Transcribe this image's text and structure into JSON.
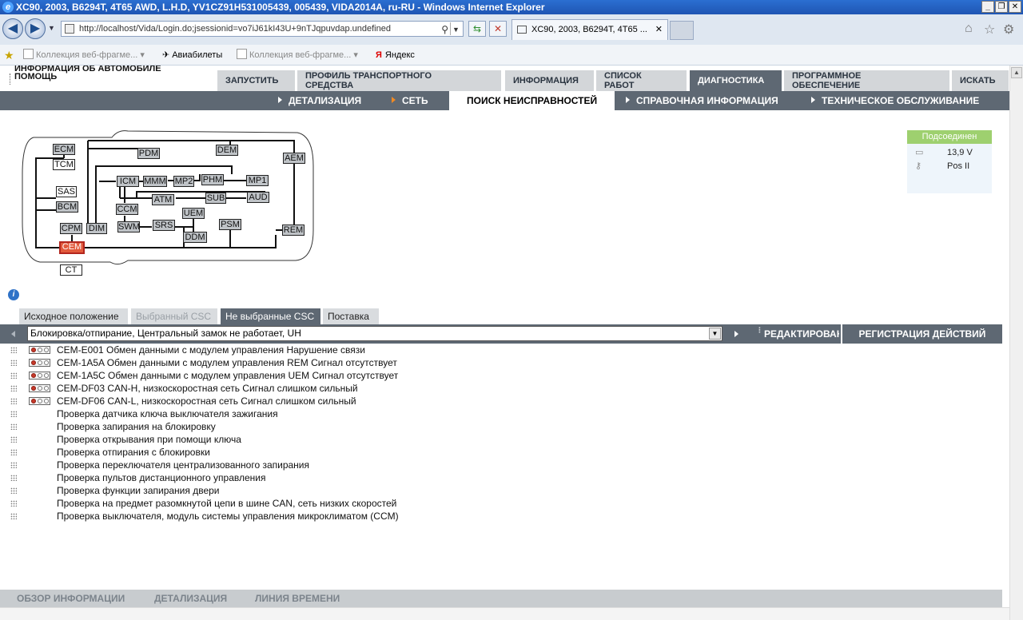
{
  "window": {
    "title": "XC90, 2003, B6294T, 4T65 AWD, L.H.D, YV1CZ91H531005439, 005439, VIDA2014A, ru-RU - Windows Internet Explorer"
  },
  "browser": {
    "url": "http://localhost/Vida/Login.do;jsessionid=vo7iJ61kI43U+9nTJqpuvdap.undefined",
    "tab_title": "XC90, 2003, B6294T, 4T65 ...",
    "favorites": [
      "Коллекция веб-фрагме...",
      "Авиабилеты",
      "Коллекция веб-фрагме...",
      "Яндекс"
    ]
  },
  "app": {
    "title_line1": "ИНФОРМАЦИЯ ОБ АВТОМОБИЛЕ",
    "title_line2": "ПОМОЩЬ",
    "main_tabs": [
      {
        "line1": "ЗАПУСТИТЬ",
        "line2": ""
      },
      {
        "line1": "ПРОФИЛЬ ТРАНСПОРТНОГО",
        "line2": "СРЕДСТВА"
      },
      {
        "line1": "ИНФОРМАЦИЯ",
        "line2": ""
      },
      {
        "line1": "СПИСОК",
        "line2": "РАБОТ"
      },
      {
        "line1": "ДИАГНОСТИКА",
        "line2": ""
      },
      {
        "line1": "ПРОГРАММНОЕ",
        "line2": "ОБЕСПЕЧЕНИЕ"
      },
      {
        "line1": "ИСКАТЬ",
        "line2": ""
      }
    ],
    "active_main_tab": "ДИАГНОСТИКА",
    "sub_tabs": [
      "ДЕТАЛИЗАЦИЯ",
      "СЕТЬ",
      "ПОИСК НЕИСПРАВНОСТЕЙ",
      "СПРАВОЧНАЯ ИНФОРМАЦИЯ",
      "ТЕХНИЧЕСКОЕ ОБСЛУЖИВАНИЕ"
    ],
    "active_sub_tab": "ПОИСК НЕИСПРАВНОСТЕЙ"
  },
  "network": {
    "modules": [
      "ECM",
      "TCM",
      "PDM",
      "DEM",
      "AEM",
      "ICM",
      "MMM",
      "MP2",
      "PHM",
      "MP1",
      "ATM",
      "SUB",
      "AUD",
      "SAS",
      "BCM",
      "CCM",
      "UEM",
      "SWM",
      "SRS",
      "DDM",
      "PSM",
      "CPM",
      "DIM",
      "REM",
      "CEM",
      "CT"
    ],
    "highlighted": "CEM"
  },
  "status": {
    "header": "Подсоединен",
    "voltage": "13,9 V",
    "key_position": "Pos II",
    "battery_icon": "battery-icon",
    "key_icon": "key-icon"
  },
  "csc": {
    "tabs": [
      "Исходное положение",
      "Выбранный CSC",
      "Не выбранные CSC",
      "Поставка"
    ],
    "active_tab": "Не выбранные CSC",
    "selected": "Блокировка/отпирание, Центральный замок не работает, UH",
    "edit_label": "РЕДАКТИРОВАНИЕ",
    "register_label": "РЕГИСТРАЦИЯ ДЕЙСТВИЙ"
  },
  "faults": [
    {
      "text": "CEM-E001 Обмен данными с модулем управления Нарушение связи",
      "dtc": true
    },
    {
      "text": "CEM-1A5A Обмен данными с модулем управления REM Сигнал отсутствует",
      "dtc": true
    },
    {
      "text": "CEM-1A5C Обмен данными с модулем управления UEM Сигнал отсутствует",
      "dtc": true
    },
    {
      "text": "CEM-DF03 CAN-H, низкоскоростная сеть Сигнал слишком сильный",
      "dtc": true
    },
    {
      "text": "CEM-DF06 CAN-L, низкоскоростная сеть Сигнал слишком сильный",
      "dtc": true
    },
    {
      "text": "Проверка датчика ключа выключателя зажигания",
      "dtc": false
    },
    {
      "text": "Проверка запирания на блокировку",
      "dtc": false
    },
    {
      "text": "Проверка открывания при помощи ключа",
      "dtc": false
    },
    {
      "text": "Проверка отпирания с блокировки",
      "dtc": false
    },
    {
      "text": "Проверка переключателя централизованного запирания",
      "dtc": false
    },
    {
      "text": "Проверка пультов дистанционного управления",
      "dtc": false
    },
    {
      "text": "Проверка функции запирания двери",
      "dtc": false
    },
    {
      "text": "Проверка на предмет разомкнутой цепи в шине CAN, сеть низких скоростей",
      "dtc": false
    },
    {
      "text": "Проверка выключателя, модуль системы управления микроклиматом (CCM)",
      "dtc": false
    }
  ],
  "bottom_nav": [
    "ОБЗОР ИНФОРМАЦИИ",
    "ДЕТАЛИЗАЦИЯ",
    "ЛИНИЯ ВРЕМЕНИ"
  ]
}
